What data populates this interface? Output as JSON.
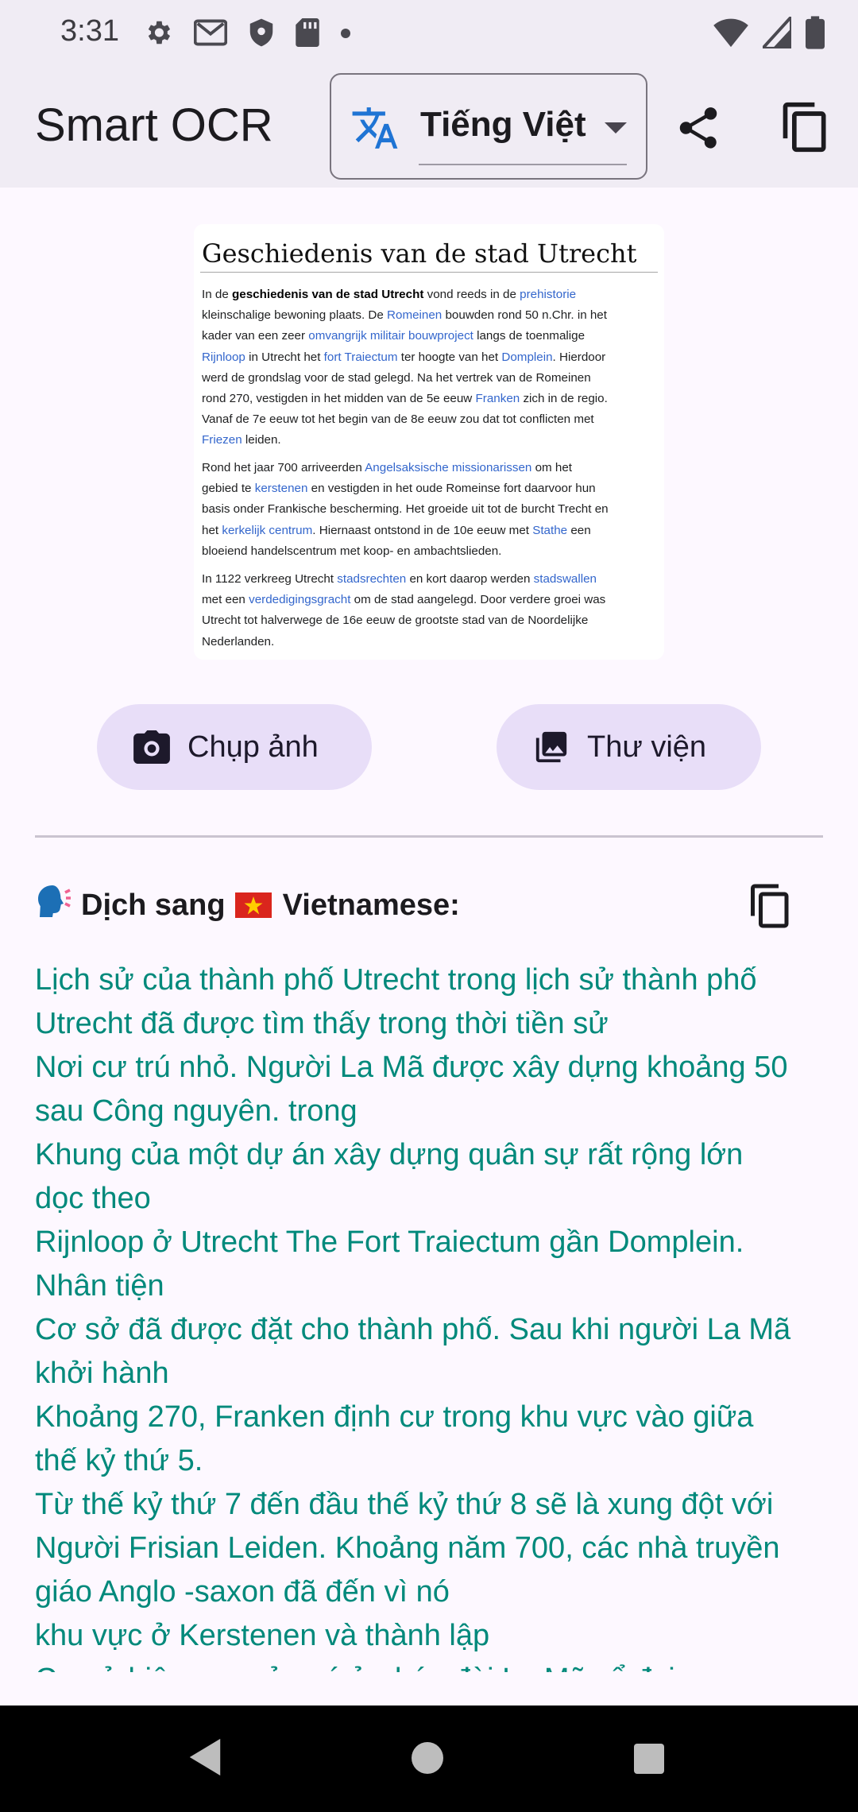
{
  "status_bar": {
    "time": "3:31",
    "icons": [
      "settings-icon",
      "gmail-icon",
      "shield-icon",
      "sd-card-icon",
      "notification-dot-icon",
      "wifi-icon",
      "signal-icon",
      "battery-icon"
    ]
  },
  "app_bar": {
    "title": "Smart OCR",
    "language_select": {
      "value": "Tiếng Việt",
      "icon": "translate-icon"
    },
    "actions": [
      "share-icon",
      "copy-icon"
    ]
  },
  "source_image": {
    "title": "Geschiedenis van de stad Utrecht",
    "paragraphs": [
      [
        [
          [
            "In de ",
            ""
          ],
          [
            "geschiedenis van de stad ",
            "b"
          ],
          [
            "Utrecht",
            "b"
          ],
          [
            " vond reeds in de ",
            ""
          ],
          [
            "prehistorie",
            "lk"
          ]
        ],
        [
          [
            "kleinschalige bewoning plaats. De ",
            ""
          ],
          [
            "Romeinen",
            "lk"
          ],
          [
            " bouwden rond 50 n.Chr. in het",
            ""
          ]
        ],
        [
          [
            "kader van een zeer ",
            ""
          ],
          [
            "omvangrijk militair bouwproject",
            "lk"
          ],
          [
            " langs de toenmalige",
            ""
          ]
        ],
        [
          [
            "Rijnloop",
            "lk"
          ],
          [
            " in Utrecht het ",
            ""
          ],
          [
            "fort Traiectum",
            "lk"
          ],
          [
            " ter hoogte van het ",
            ""
          ],
          [
            "Domplein",
            "lk"
          ],
          [
            ". Hierdoor",
            ""
          ]
        ],
        [
          [
            "werd de grondslag voor de stad gelegd. Na het vertrek van de Romeinen",
            ""
          ]
        ],
        [
          [
            "rond 270, vestigden in het midden van de 5e eeuw ",
            ""
          ],
          [
            "Franken",
            "lk"
          ],
          [
            " zich in de regio.",
            ""
          ]
        ],
        [
          [
            "Vanaf de 7e eeuw tot het begin van de 8e eeuw zou dat tot conflicten met",
            ""
          ]
        ],
        [
          [
            "Friezen",
            "lk"
          ],
          [
            " leiden.",
            ""
          ]
        ]
      ],
      [
        [
          [
            "Rond het jaar 700 arriveerden ",
            ""
          ],
          [
            "Angelsaksische missionarissen",
            "lk"
          ],
          [
            " om het",
            ""
          ]
        ],
        [
          [
            "gebied te ",
            ""
          ],
          [
            "kerstenen",
            "lk"
          ],
          [
            " en vestigden in het oude Romeinse fort daarvoor hun",
            ""
          ]
        ],
        [
          [
            "basis onder Frankische bescherming. Het groeide uit tot de burcht Trecht en",
            ""
          ]
        ],
        [
          [
            "het ",
            ""
          ],
          [
            "kerkelijk centrum",
            "lk"
          ],
          [
            ". Hiernaast ontstond in de 10e eeuw met ",
            ""
          ],
          [
            "Stathe",
            "lk"
          ],
          [
            " een",
            ""
          ]
        ],
        [
          [
            "bloeiend handelscentrum met koop- en ambachtslieden.",
            ""
          ]
        ]
      ],
      [
        [
          [
            "In 1122 verkreeg Utrecht ",
            ""
          ],
          [
            "stadsrechten",
            "lk"
          ],
          [
            " en kort daarop werden ",
            ""
          ],
          [
            "stadswallen",
            "lk"
          ]
        ],
        [
          [
            "met een ",
            ""
          ],
          [
            "verdedigingsgracht",
            "lk"
          ],
          [
            " om de stad aangelegd. Door verdere groei was",
            ""
          ]
        ],
        [
          [
            "Utrecht tot halverwege de 16e eeuw de grootste stad van de Noordelijke",
            ""
          ]
        ],
        [
          [
            "Nederlanden.",
            ""
          ]
        ]
      ]
    ]
  },
  "buttons": {
    "camera_label": "Chụp ảnh",
    "gallery_label": "Thư viện"
  },
  "translation": {
    "header_prefix": "Dịch sang",
    "header_language": "Vietnamese:",
    "lines": [
      "Lịch sử của thành phố Utrecht trong lịch sử thành phố",
      "Utrecht đã được tìm thấy trong thời tiền sử",
      "Nơi cư trú nhỏ. Người La Mã được xây dựng khoảng 50",
      "sau Công nguyên. trong",
      "Khung của một dự án xây dựng quân sự rất rộng lớn",
      "dọc theo",
      "Rijnloop ở Utrecht The Fort Traiectum gần Domplein.",
      "Nhân tiện",
      "Cơ sở đã được đặt cho thành phố. Sau khi người La Mã",
      "khởi hành",
      "Khoảng 270, Franken định cư trong khu vực vào giữa",
      "thế kỷ thứ 5.",
      "Từ thế kỷ thứ 7 đến đầu thế kỷ thứ 8 sẽ là xung đột với",
      "Người Frisian Leiden. Khoảng năm 700, các nhà truyền",
      "giáo Anglo -saxon đã đến vì nó",
      "khu vực ở Kerstenen và thành lập",
      "Cơ sở hiện nay của nó ở pháo đài La Mã cổ đại"
    ],
    "text_color": "#00897b"
  },
  "nav_bar": {
    "buttons": [
      "back-icon",
      "home-icon",
      "recents-icon"
    ]
  }
}
